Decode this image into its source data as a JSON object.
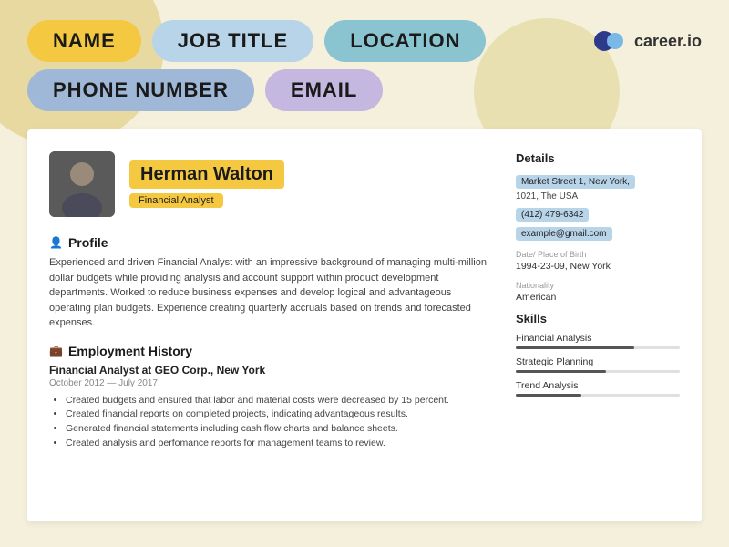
{
  "header": {
    "pill1": "NAME",
    "pill2": "JOB TITLE",
    "pill3": "LOCATION",
    "pill4": "PHONE NUMBER",
    "pill5": "EMAIL",
    "logo_text": "career.io"
  },
  "resume": {
    "name": "Herman Walton",
    "job_title": "Financial Analyst",
    "profile_section": {
      "title": "Profile",
      "body": "Experienced and driven Financial Analyst with an impressive background of managing multi-million dollar budgets while providing analysis and account support within product development departments. Worked to reduce business expenses and develop logical and advantageous operating plan budgets. Experience creating quarterly accruals based on trends and forecasted expenses."
    },
    "employment_section": {
      "title": "Employment History",
      "job": "Financial Analyst at GEO Corp., New York",
      "dates": "October 2012 — July 2017",
      "bullets": [
        "Created budgets and ensured that labor and material costs were decreased by 15 percent.",
        "Created financial reports on completed projects, indicating advantageous results.",
        "Generated financial statements including cash flow charts and balance sheets.",
        "Created analysis and perfomance reports for management teams to review."
      ]
    },
    "details": {
      "title": "Details",
      "address1": "Market Street 1, New York,",
      "address2": "1021, The USA",
      "phone": "(412) 479-6342",
      "email": "example@gmail.com",
      "dob_label": "Date/ Place of Birth",
      "dob_value": "1994-23-09, New York",
      "nationality_label": "Nationality",
      "nationality_value": "American"
    },
    "skills": {
      "title": "Skills",
      "items": [
        {
          "name": "Financial Analysis",
          "level": 72
        },
        {
          "name": "Strategic Planning",
          "level": 55
        },
        {
          "name": "Trend Analysis",
          "level": 40
        }
      ]
    }
  }
}
